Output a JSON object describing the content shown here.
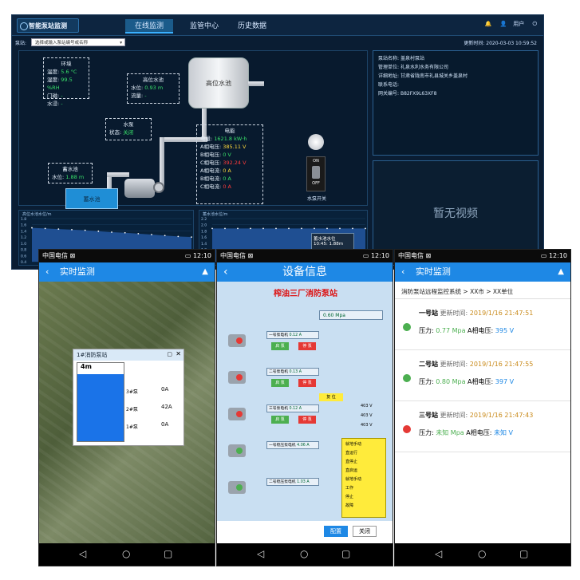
{
  "desktop": {
    "logo": "智能泵站监测",
    "tabs": [
      "在线监测",
      "监管中心",
      "历史数据"
    ],
    "user_label": "用户",
    "station_label": "泵站:",
    "station_select_placeholder": "选择或输入泵站编号或名称",
    "update_time_label": "更新时间:",
    "update_time": "2020-03-03 10:59:52",
    "env": {
      "title": "环境",
      "temp_label": "温度:",
      "temp": "5.6 °C",
      "humidity_label": "湿度:",
      "humidity": "99.5 %RH",
      "door_label": "门磁:",
      "door": "-",
      "water_immersion_label": "水浸:",
      "water_immersion": "-"
    },
    "high_tank": {
      "title": "高位水池",
      "level_label": "水位:",
      "level": "0.93 m",
      "flow_label": "流量:",
      "flow": "-",
      "tank_label": "高位水池"
    },
    "pump": {
      "title": "水泵",
      "status_label": "状态:",
      "status": "关闭"
    },
    "reservoir": {
      "title": "蓄水池",
      "level_label": "水位:",
      "level": "1.88 m",
      "tank_label": "蓄水池"
    },
    "power": {
      "title": "电能",
      "rows": [
        {
          "label": "电量:",
          "value": "1621.8 kW·h",
          "color": "#39e06a"
        },
        {
          "label": "A相电压:",
          "value": "385.11 V",
          "color": "#ffd93b"
        },
        {
          "label": "B相电压:",
          "value": "0 V",
          "color": "#39e06a"
        },
        {
          "label": "C相电压:",
          "value": "392.24 V",
          "color": "#ff3b3b"
        },
        {
          "label": "A相电流:",
          "value": "0 A",
          "color": "#ffd93b"
        },
        {
          "label": "B相电流:",
          "value": "0 A",
          "color": "#39e06a"
        },
        {
          "label": "C相电流:",
          "value": "0 A",
          "color": "#ff3b3b"
        }
      ]
    },
    "switch": {
      "on": "ON",
      "off": "OFF",
      "label": "水泵开关"
    },
    "info_panel": [
      {
        "label": "泵站名称:",
        "value": "盖泉村泵站"
      },
      {
        "label": "管理单位:",
        "value": "礼泉水利水务有限公司"
      },
      {
        "label": "详细地址:",
        "value": "甘肃省陇南市礼县城关乡盖泉村"
      },
      {
        "label": "联系电话:",
        "value": ""
      },
      {
        "label": "网关编号:",
        "value": "B82FX9L63XF8"
      }
    ],
    "video_text": "暂无视频",
    "chart_left_title": "高位水池水位/m",
    "chart_right_title": "蓄水池水位/m",
    "tooltip_title": "蓄水池水位",
    "tooltip_value": "10:45: 1.88m"
  },
  "chart_data": [
    {
      "type": "line",
      "title": "高位水池水位/m",
      "yticks": [
        "1.8",
        "1.6",
        "1.4",
        "1.2",
        "1.0",
        "0.8",
        "0.6",
        "0.4"
      ],
      "ylim": [
        0.4,
        1.8
      ],
      "values": [
        1.5,
        1.48,
        1.46,
        1.44,
        1.42,
        1.39,
        1.36,
        1.34,
        1.31,
        1.28,
        1.25,
        1.22,
        1.2
      ]
    },
    {
      "type": "line",
      "title": "蓄水池水位/m",
      "yticks": [
        "2.2",
        "2.0",
        "1.8",
        "1.6",
        "1.4",
        "1.2",
        "1.0",
        "0.8"
      ],
      "ylim": [
        0.8,
        2.2
      ],
      "values": [
        1.88,
        1.88,
        1.88,
        1.88,
        1.88,
        1.88,
        1.88,
        1.88,
        1.88,
        1.88,
        1.88,
        1.88,
        1.88
      ]
    }
  ],
  "phone1": {
    "carrier": "中国电信",
    "time": "12:10",
    "battery": "",
    "title": "实时监测",
    "map_popup_title": "1#消防泵站",
    "water_level": "4m",
    "pumps": [
      "3#泵",
      "2#泵",
      "1#泵"
    ],
    "currents": [
      "0A",
      "42A",
      "0A"
    ]
  },
  "phone2": {
    "carrier": "中国电信",
    "time": "12:10",
    "title": "设备信息",
    "station_title": "榨油三厂消防泵站",
    "pressure_value": "0.60 Mpa",
    "pumps": [
      {
        "name": "一号泵电机",
        "current": "0.12 A",
        "start": "启 泵",
        "stop": "停 泵"
      },
      {
        "name": "二号泵电机",
        "current": "0.13 A",
        "start": "启 泵",
        "stop": "停 泵"
      },
      {
        "name": "三号泵电机",
        "current": "0.12 A",
        "start": "启 泵",
        "stop": "停 泵"
      },
      {
        "name": "一号稳压泵电机",
        "current": "4.06 A",
        "start": "",
        "stop": ""
      },
      {
        "name": "二号稳压泵电机",
        "current": "1.03 A",
        "start": "",
        "stop": ""
      }
    ],
    "reset": "复 位",
    "volt_values": [
      "403 V",
      "403 V",
      "403 V"
    ],
    "legend": [
      "就地手动",
      "直运行",
      "直停止",
      "直启运",
      "就地手动",
      "工作",
      "停止",
      "故障"
    ],
    "config_button": "配置",
    "close_button": "关闭"
  },
  "phone3": {
    "carrier": "中国电信",
    "time": "12:10",
    "title": "实时监测",
    "breadcrumb": [
      "消防泵站远程监控系统",
      "XX市",
      "XX单位"
    ],
    "stations": [
      {
        "name": "一号站",
        "update_label": "更新时间:",
        "time": "2019/1/16 21:47:51",
        "pressure_label": "压力:",
        "pressure": "0.77 Mpa",
        "voltage_label": "A相电压:",
        "voltage": "395 V",
        "status_color": "#4caf50",
        "pressure_color": "#4caf50"
      },
      {
        "name": "二号站",
        "update_label": "更新时间:",
        "time": "2019/1/16 21:47:55",
        "pressure_label": "压力:",
        "pressure": "0.80 Mpa",
        "voltage_label": "A相电压:",
        "voltage": "397 V",
        "status_color": "#4caf50",
        "pressure_color": "#4caf50"
      },
      {
        "name": "三号站",
        "update_label": "更新时间:",
        "time": "2019/1/16 21:47:43",
        "pressure_label": "压力:",
        "pressure": "未知 Mpa",
        "voltage_label": "A相电压:",
        "voltage": "未知 V",
        "status_color": "#e53935",
        "pressure_color": "#4caf50"
      }
    ]
  }
}
